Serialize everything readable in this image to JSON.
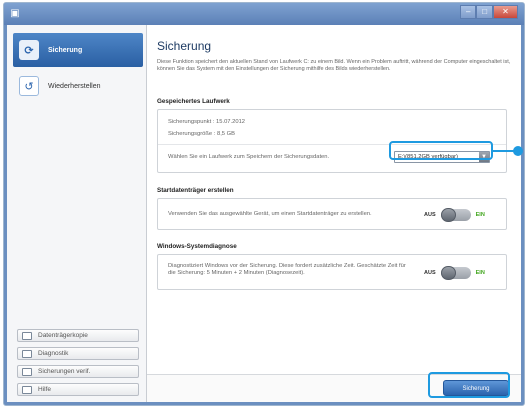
{
  "window": {
    "title": "",
    "close_label": "✕"
  },
  "sidebar": {
    "items": [
      {
        "label": "Sicherung",
        "active": true,
        "icon": "backup-icon"
      },
      {
        "label": "Wiederherstellen",
        "active": false,
        "icon": "restore-icon"
      }
    ],
    "bottom_buttons": [
      {
        "label": "Datenträgerkopie",
        "icon": "disk-copy-icon"
      },
      {
        "label": "Diagnostik",
        "icon": "diagnostics-icon"
      },
      {
        "label": "Sicherungen verif.",
        "icon": "verify-icon"
      },
      {
        "label": "Hilfe",
        "icon": "help-icon"
      }
    ]
  },
  "main": {
    "title": "Sicherung",
    "description": "Diese Funktion speichert den aktuellen Stand von Laufwerk C: zu einem Bild. Wenn ein Problem auftritt, während der Computer eingeschaltet ist, können Sie das System mit den Einstellungen der Sicherung mithilfe des Bilds wiederherstellen.",
    "saved_drive": {
      "heading": "Gespeichertes Laufwerk",
      "backup_date": "Sicherungspunkt : 15.07.2012",
      "backup_size": "Sicherungsgröße : 8,5 GB",
      "select_prompt": "Wählen Sie ein Laufwerk zum Speichern der Sicherungsdaten.",
      "drive_value": "E:\\(851,2GB verfügbar)"
    },
    "boot_media": {
      "heading": "Startdatenträger erstellen",
      "text": "Verwenden Sie das ausgewählte Gerät, um einen Startdatenträger zu erstellen.",
      "toggle_off": "AUS",
      "toggle_on": "EIN",
      "enabled": false
    },
    "diagnostics": {
      "heading": "Windows-Systemdiagnose",
      "text": "Diagnostiziert Windows vor der Sicherung. Diese fordert zusätzliche Zeit. Geschätzte Zeit für die Sicherung: 5 Minuten + 2 Minuten (Diagnosezeit).",
      "toggle_off": "AUS",
      "toggle_on": "EIN",
      "enabled": false
    },
    "save_button": "Sicherung"
  },
  "colors": {
    "accent": "#2b63ad",
    "callout": "#1e9ae0",
    "toggle_on": "#3fa51b"
  }
}
